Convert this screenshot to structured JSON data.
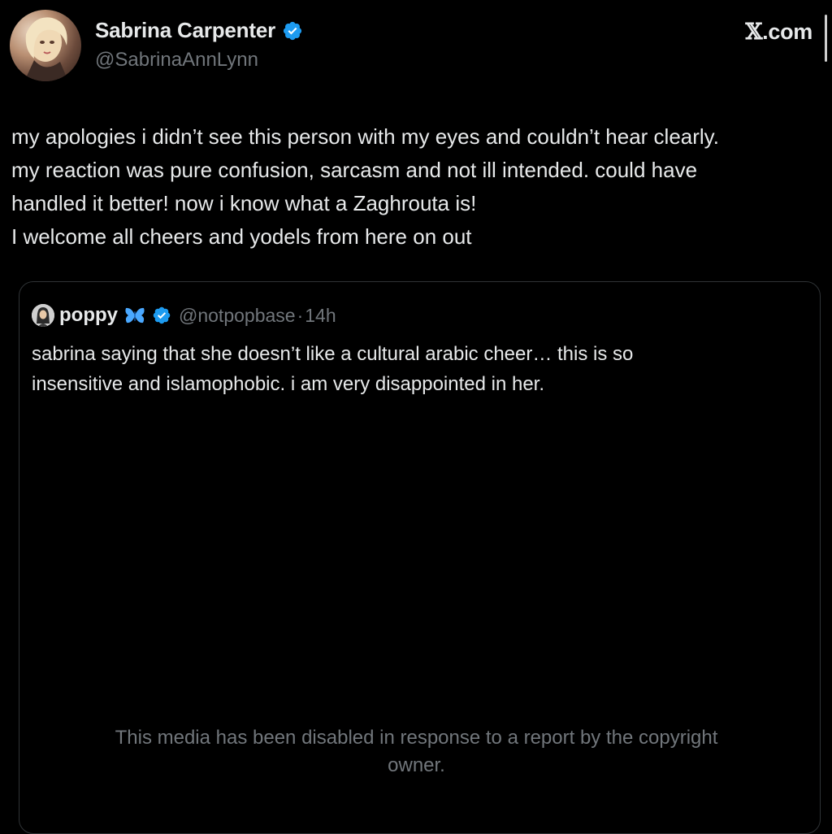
{
  "author": {
    "display_name": "Sabrina Carpenter",
    "handle": "@SabrinaAnnLynn",
    "verified": true,
    "avatar_icon": "avatar-photo"
  },
  "brand": {
    "glyph": "𝕏",
    "label": ".com"
  },
  "tweet": {
    "lines": [
      "my apologies i didn’t see this person with my eyes and couldn’t hear clearly.",
      "my reaction was pure confusion, sarcasm and not ill intended. could have",
      "handled it better! now i know what a Zaghrouta is!",
      "I welcome all cheers and yodels from here on out"
    ]
  },
  "quoted_tweet": {
    "display_name": "poppy",
    "emoji_icon": "butterfly-icon",
    "verified": true,
    "handle": "@notpopbase",
    "separator": "·",
    "time": "14h",
    "lines": [
      "sabrina saying that she doesn’t like a cultural arabic cheer… this is so",
      "insensitive and islamophobic. i am very disappointed in her."
    ],
    "media_notice": [
      "This media has been disabled in response to a report by the copyright",
      "owner."
    ]
  },
  "colors": {
    "background": "#000000",
    "text_primary": "#e7e9ea",
    "text_secondary": "#71767b",
    "verified_blue": "#1d9bf0",
    "border": "#2f3336",
    "butterfly_blue": "#4aa8ff"
  }
}
